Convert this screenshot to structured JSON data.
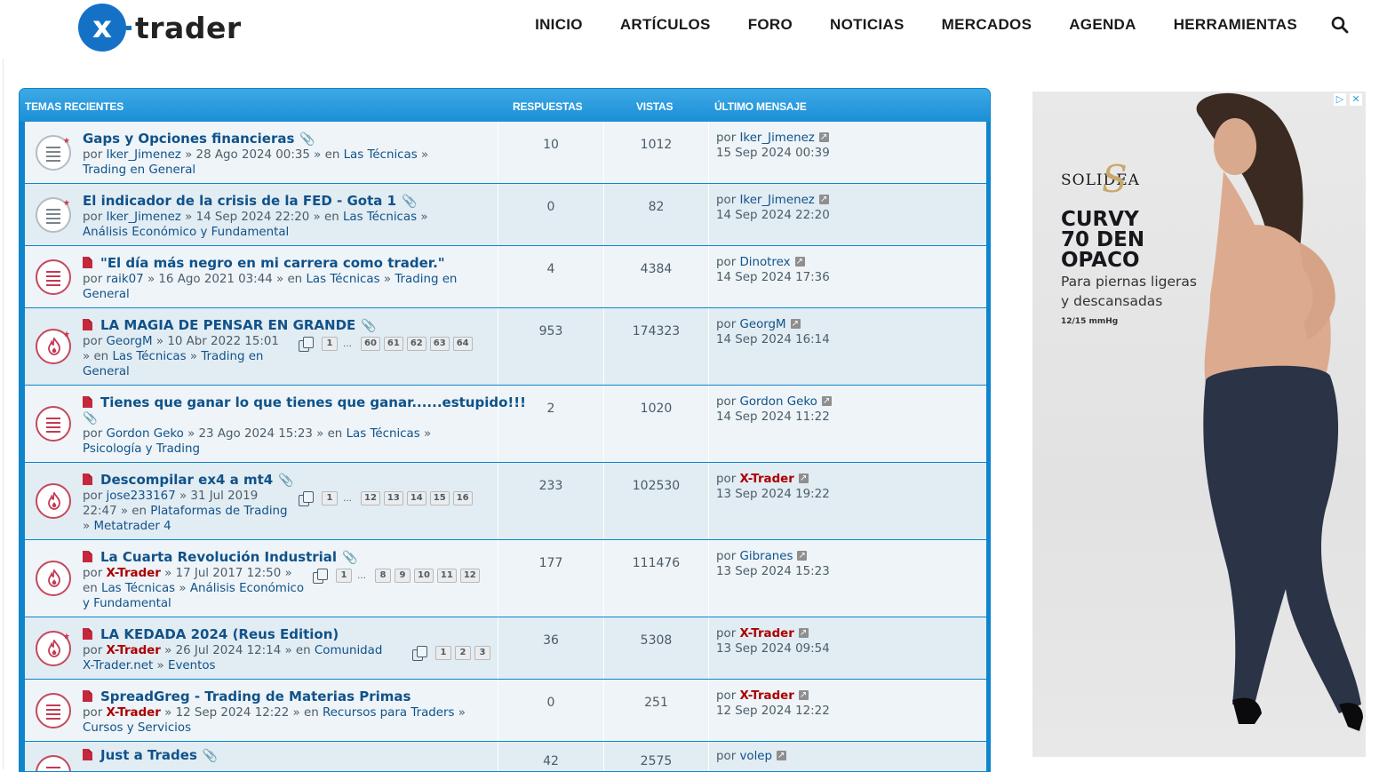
{
  "header": {
    "logo_mark": "x",
    "logo_text": "trader",
    "nav": [
      "INICIO",
      "ARTÍCULOS",
      "FORO",
      "NOTICIAS",
      "MERCADOS",
      "AGENDA",
      "HERRAMIENTAS"
    ]
  },
  "table": {
    "headers": {
      "topics": "TEMAS RECIENTES",
      "replies": "RESPUESTAS",
      "views": "VISTAS",
      "last": "ÚLTIMO MENSAJE"
    },
    "rows": [
      {
        "title": "Gaps y Opciones financieras",
        "meta1": "por ",
        "author": "Iker_Jimenez",
        "meta2": " » 28 Ago 2024 00:35 » en ",
        "forum": "Las Técnicas",
        "sep": " »",
        "sub": "Trading en General",
        "replies": "10",
        "views": "1012",
        "last_by": "por ",
        "last_user": "Iker_Jimenez",
        "last_date": "15 Sep 2024 00:39"
      },
      {
        "title": "El indicador de la crisis de la FED - Gota 1",
        "meta1": "por ",
        "author": "Iker_Jimenez",
        "meta2": " » 14 Sep 2024 22:20 » en ",
        "forum": "Las Técnicas",
        "sep": " »",
        "sub": "Análisis Económico y Fundamental",
        "replies": "0",
        "views": "82",
        "last_by": "por ",
        "last_user": "Iker_Jimenez",
        "last_date": "14 Sep 2024 22:20"
      },
      {
        "title": "\"El día más negro en mi carrera como trader.\"",
        "meta1": "por ",
        "author": "raik07",
        "meta2": " » 16 Ago 2021 03:44 » en ",
        "forum": "Las Técnicas",
        "sep": " » ",
        "sub": "Trading en",
        "sub2": "General",
        "replies": "4",
        "views": "4384",
        "last_by": "por ",
        "last_user": "Dinotrex",
        "last_date": "14 Sep 2024 17:36"
      },
      {
        "title": "LA MAGIA DE PENSAR EN GRANDE",
        "meta1": "por ",
        "author": "GeorgM",
        "meta2": " » 10 Abr 2022 15:01",
        "meta3": " » en ",
        "forum": "Las Técnicas",
        "sep": " » ",
        "sub": "Trading en",
        "sub2": "General",
        "pages": [
          "1",
          "…",
          "60",
          "61",
          "62",
          "63",
          "64"
        ],
        "replies": "953",
        "views": "174323",
        "last_by": "por ",
        "last_user": "GeorgM",
        "last_date": "14 Sep 2024 16:14"
      },
      {
        "title": "Tienes que ganar lo que tienes que ganar......estupido!!!",
        "meta1": "por ",
        "author": "Gordon Geko",
        "meta2": " » 23 Ago 2024 15:23 » en ",
        "forum": "Las Técnicas",
        "sep": " »",
        "sub": "Psicología y Trading",
        "replies": "2",
        "views": "1020",
        "last_by": "por ",
        "last_user": "Gordon Geko",
        "last_date": "14 Sep 2024 11:22"
      },
      {
        "title": "Descompilar ex4 a mt4",
        "meta1": "por ",
        "author": "jose233167",
        "meta2": " » 31 Jul 2019",
        "meta3": "22:47 » en ",
        "forum": "Plataformas de Trading",
        "sep": "» ",
        "sub": "Metatrader 4",
        "pages": [
          "1",
          "…",
          "12",
          "13",
          "14",
          "15",
          "16"
        ],
        "replies": "233",
        "views": "102530",
        "last_by": "por ",
        "last_user": "X-Trader",
        "last_date": "13 Sep 2024 19:22"
      },
      {
        "title": "La Cuarta Revolución Industrial",
        "meta1": "por ",
        "author": "X-Trader",
        "meta2": " » 17 Jul 2017 12:50 »",
        "meta3": "en ",
        "forum": "Las Técnicas",
        "sep": " » ",
        "sub": "Análisis Económico",
        "sub2": "y Fundamental",
        "pages": [
          "1",
          "…",
          "8",
          "9",
          "10",
          "11",
          "12"
        ],
        "replies": "177",
        "views": "111476",
        "last_by": "por ",
        "last_user": "Gibranes",
        "last_date": "13 Sep 2024 15:23"
      },
      {
        "title": "LA KEDADA 2024 (Reus Edition)",
        "meta1": "por ",
        "author": "X-Trader",
        "meta2": " » 26 Jul 2024 12:14 » en ",
        "forum": "Comunidad",
        "sub": "X-Trader.net",
        "sep": " » ",
        "sub2": "Eventos",
        "pages": [
          "1",
          "2",
          "3"
        ],
        "replies": "36",
        "views": "5308",
        "last_by": "por ",
        "last_user": "X-Trader",
        "last_date": "13 Sep 2024 09:54"
      },
      {
        "title": "SpreadGreg - Trading de Materias Primas",
        "meta1": "por ",
        "author": "X-Trader",
        "meta2": " » 12 Sep 2024 12:22 » en ",
        "forum": "Recursos para Traders",
        "sep": " »",
        "sub": "Cursos y Servicios",
        "replies": "0",
        "views": "251",
        "last_by": "por ",
        "last_user": "X-Trader",
        "last_date": "12 Sep 2024 12:22"
      },
      {
        "title": "Just a Trades",
        "replies": "42",
        "views": "2575",
        "last_by": "por ",
        "last_user": "volep"
      }
    ]
  },
  "ad": {
    "brand": "SOLIDEA",
    "brand_mark": "S",
    "headline": [
      "CURVY",
      "70 DEN",
      "OPACO"
    ],
    "sub": [
      "Para piernas ligeras",
      "y descansadas"
    ],
    "small": "12/15 mmHg",
    "adchoices": "▷",
    "close": "✕"
  },
  "colors": {
    "accent": "#0e85cd",
    "link": "#105289",
    "admin": "#aa0000",
    "hot": "#c5283d"
  }
}
